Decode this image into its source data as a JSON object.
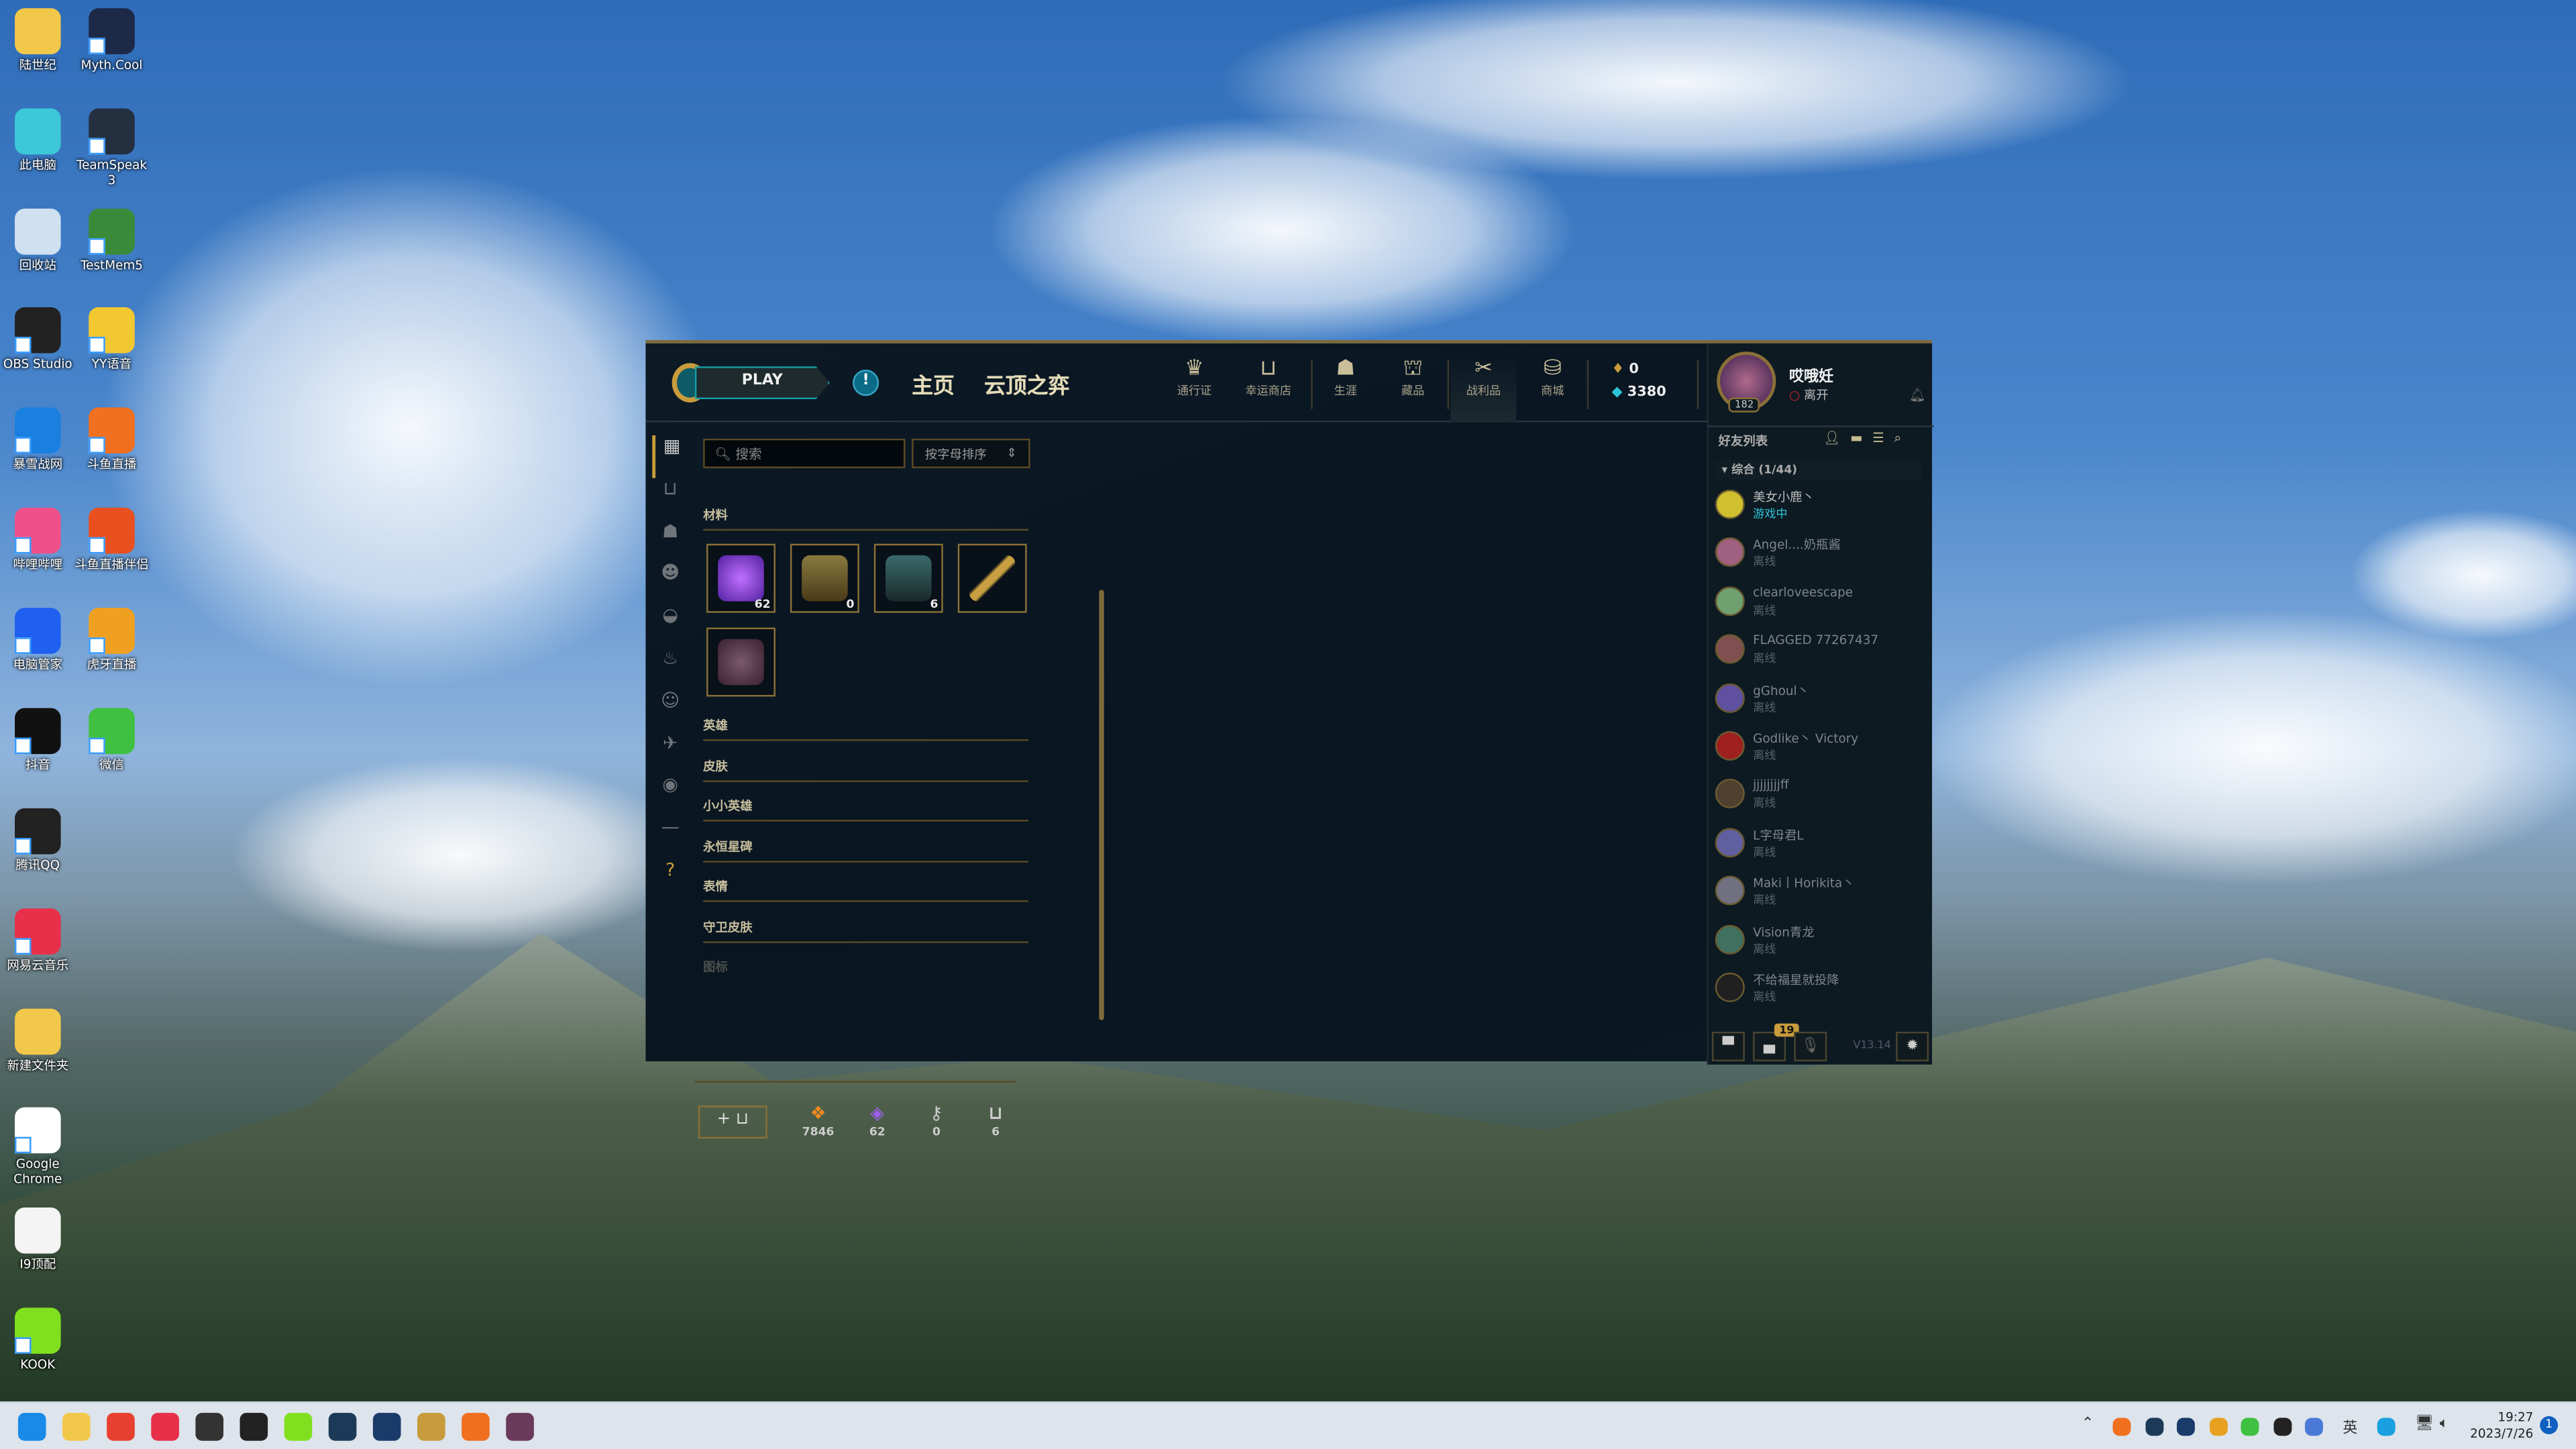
{
  "desktop": {
    "col1": [
      "陆世纪",
      "此电脑",
      "回收站",
      "OBS Studio",
      "暴雪战网",
      "哔哩哔哩",
      "电脑管家",
      "抖音",
      "腾讯QQ",
      "网易云音乐",
      "新建文件夹",
      "Google Chrome",
      "I9顶配",
      "KOOK"
    ],
    "col2": [
      "Myth.Cool",
      "TeamSpeak 3",
      "TestMem5",
      "YY语音",
      "斗鱼直播",
      "斗鱼直播伴侣",
      "虎牙直播",
      "微信"
    ]
  },
  "client": {
    "play": "PLAY",
    "alert_icon": "!",
    "nav_main": [
      "主页",
      "云顶之弈"
    ],
    "nav_buttons": [
      {
        "label": "通行证",
        "icon": "crown-icon"
      },
      {
        "label": "幸运商店",
        "icon": "loot-icon"
      },
      {
        "label": "生涯",
        "icon": "profile-icon"
      },
      {
        "label": "藏品",
        "icon": "bag-icon"
      },
      {
        "label": "战利品",
        "icon": "loot-crafting-icon",
        "active": true
      },
      {
        "label": "商城",
        "icon": "coins-icon"
      }
    ],
    "currency": {
      "rp": "0",
      "be": "3380"
    },
    "profile": {
      "name": "哎哦妊",
      "status": "离开",
      "level": "182"
    },
    "loot": {
      "search_placeholder": "搜索",
      "sort": "按字母排序",
      "sections": [
        "材料",
        "英雄",
        "皮肤",
        "小小英雄",
        "永恒星碑",
        "表情",
        "守卫皮肤",
        "图标"
      ],
      "materials": [
        {
          "name": "mythic essence",
          "count": "62"
        },
        {
          "name": "chest",
          "count": "0"
        },
        {
          "name": "masterwork chest",
          "count": "6"
        },
        {
          "name": "key fragment",
          "count": ""
        },
        {
          "name": "orb",
          "count": ""
        }
      ],
      "footer": {
        "add_label": "+",
        "values": [
          "7846",
          "62",
          "0",
          "6"
        ]
      }
    },
    "friends": {
      "title": "好友列表",
      "group": "综合 (1/44)",
      "list": [
        {
          "name": "美女小鹿丶",
          "status": "游戏中",
          "online": true
        },
        {
          "name": "Angel....奶瓶酱",
          "status": "离线"
        },
        {
          "name": "clearloveescape",
          "status": "离线"
        },
        {
          "name": "FLAGGED 77267437",
          "status": "离线"
        },
        {
          "name": "gGhoul丶",
          "status": "离线"
        },
        {
          "name": "Godlike丶 Victory",
          "status": "离线"
        },
        {
          "name": "jjjjjjjjff",
          "status": "离线"
        },
        {
          "name": "L字母君L",
          "status": "离线"
        },
        {
          "name": "Maki丨Horikita丶",
          "status": "离线"
        },
        {
          "name": "Vision青龙",
          "status": "离线"
        },
        {
          "name": "不给福星就投降",
          "status": "离线"
        }
      ],
      "badge": "19",
      "version": "V13.14"
    }
  },
  "taskbar": {
    "time": "19:27",
    "date": "2023/7/26",
    "notif": "1",
    "ime": "英"
  },
  "colors": {
    "gold": "#c89b3c",
    "teal": "#14a0a8",
    "online": "#2ec4d8"
  }
}
